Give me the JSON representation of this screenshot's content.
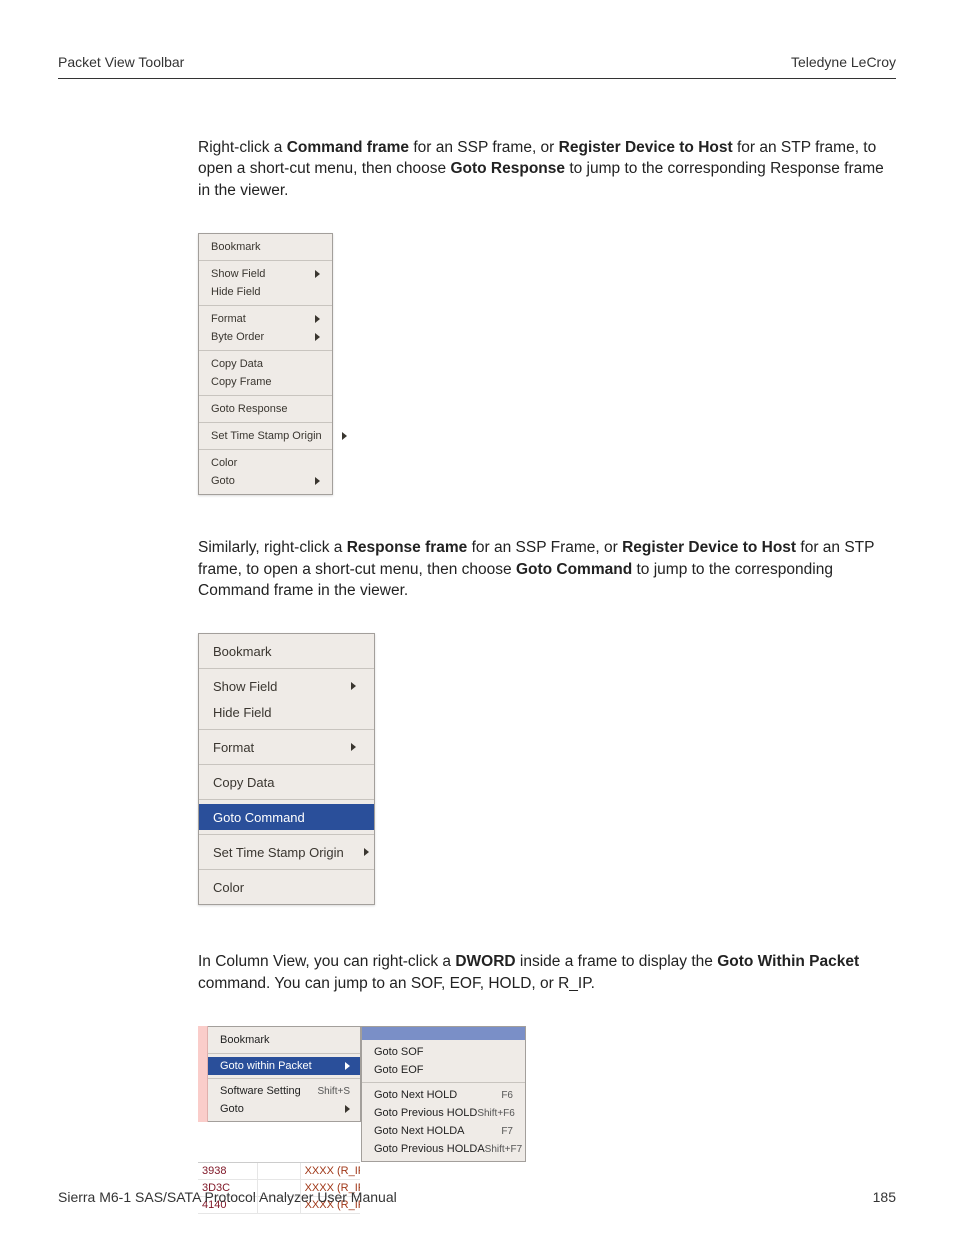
{
  "header": {
    "left": "Packet View Toolbar",
    "right": "Teledyne LeCroy"
  },
  "para1": {
    "pre": "Right-click a ",
    "b1": "Command frame",
    "mid1": " for an SSP frame, or ",
    "b2": "Register Device to Host",
    "mid2": " for an STP frame, to open a short-cut menu, then choose ",
    "b3": "Goto Response",
    "post": " to jump to the corresponding Response frame in the viewer."
  },
  "menu1": {
    "bookmark": "Bookmark",
    "show_field": "Show Field",
    "hide_field": "Hide Field",
    "format": "Format",
    "byte_order": "Byte Order",
    "copy_data": "Copy Data",
    "copy_frame": "Copy Frame",
    "goto_response": "Goto Response",
    "set_ts_origin": "Set Time Stamp Origin",
    "color": "Color",
    "goto": "Goto"
  },
  "para2": {
    "pre": "Similarly, right-click a ",
    "b1": "Response frame",
    "mid1": " for an SSP Frame, or ",
    "b2": "Register Device to Host",
    "mid2": " for an STP frame, to open a short-cut menu, then choose ",
    "b3": "Goto Command",
    "post": " to jump to the corresponding Command frame in the viewer."
  },
  "menu2": {
    "bookmark": "Bookmark",
    "show_field": "Show Field",
    "hide_field": "Hide Field",
    "format": "Format",
    "copy_data": "Copy Data",
    "goto_command": "Goto Command",
    "set_ts_origin": "Set Time Stamp Origin",
    "color": "Color"
  },
  "para3": {
    "pre": "In Column View, you can right-click a ",
    "b1": "DWORD",
    "mid1": " inside a frame to display the ",
    "b2": "Goto Within Packet",
    "post": " command. You can jump to an SOF, EOF, HOLD, or R_IP."
  },
  "cv_menu": {
    "bookmark": "Bookmark",
    "goto_within": "Goto within Packet",
    "sw_setting": "Software Setting",
    "sw_setting_sc": "Shift+S",
    "goto": "Goto"
  },
  "cv_sub": {
    "goto_sof": "Goto SOF",
    "goto_eof": "Goto EOF",
    "goto_next_hold": "Goto Next HOLD",
    "goto_next_hold_sc": "F6",
    "goto_prev_hold": "Goto Previous HOLD",
    "goto_prev_hold_sc": "Shift+F6",
    "goto_next_holda": "Goto Next HOLDA",
    "goto_next_holda_sc": "F7",
    "goto_prev_holda": "Goto Previous HOLDA",
    "goto_prev_holda_sc": "Shift+F7"
  },
  "cv_rows": [
    {
      "c1": "3938",
      "c3": "XXXX (R_IP"
    },
    {
      "c1": "3D3C",
      "c3": "XXXX (R_IP"
    },
    {
      "c1": "4140",
      "c3": "XXXX (R_IP"
    }
  ],
  "footer": {
    "left": "Sierra M6-1 SAS/SATA Protocol Analyzer User Manual",
    "right": "185"
  }
}
